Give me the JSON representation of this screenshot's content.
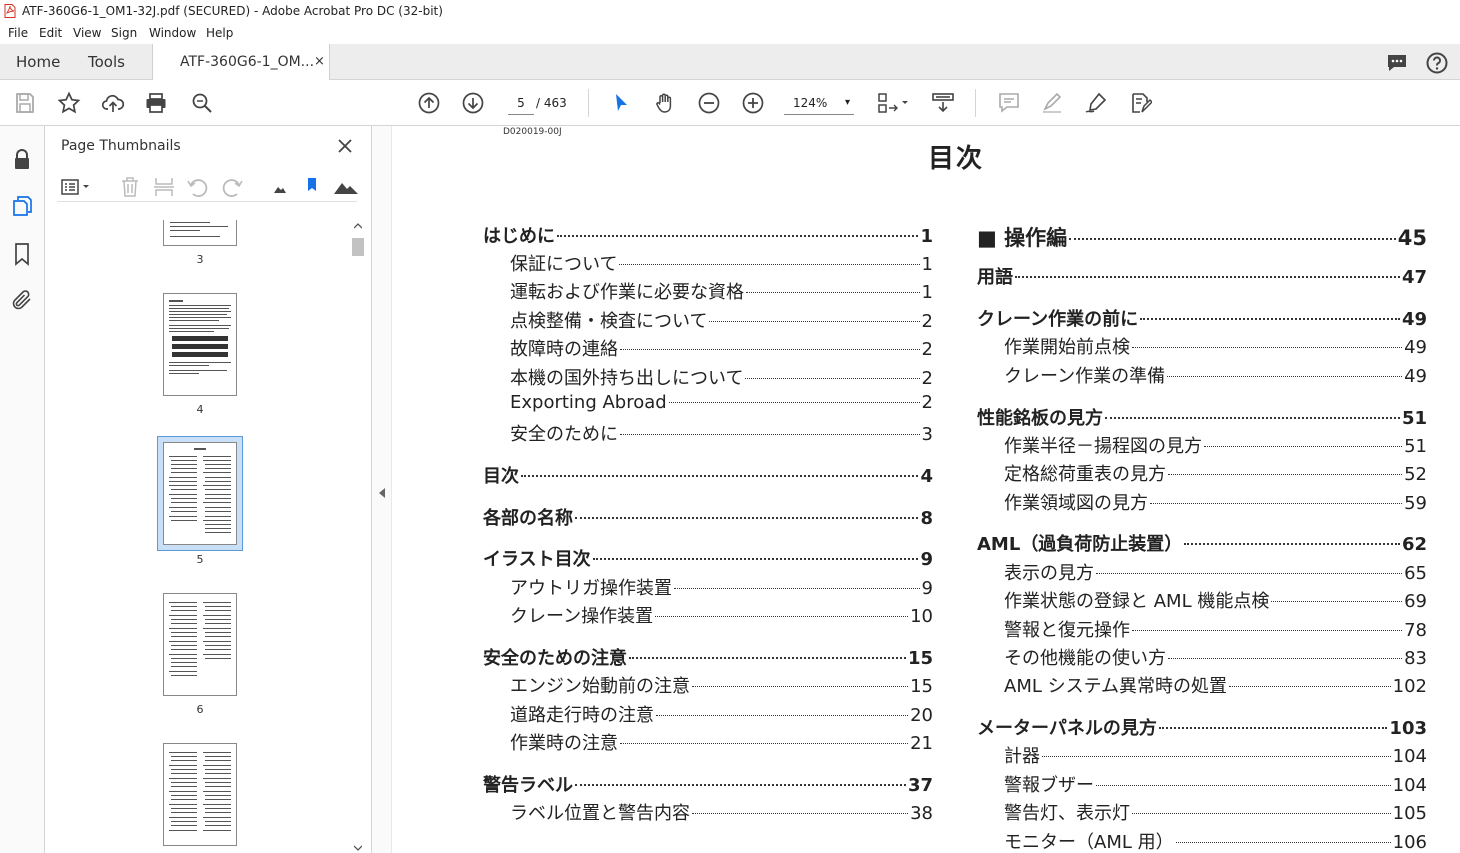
{
  "window": {
    "title": "ATF-360G6-1_OM1-32J.pdf (SECURED) - Adobe Acrobat Pro DC (32-bit)"
  },
  "menu": [
    "File",
    "Edit",
    "View",
    "Sign",
    "Window",
    "Help"
  ],
  "tabs": {
    "home": "Home",
    "tools": "Tools",
    "document": "ATF-360G6-1_OM...",
    "close": "×"
  },
  "toolbar": {
    "page_current": "5",
    "page_total": "/ 463",
    "zoom": "124%",
    "zoom_arrow": "▾"
  },
  "panel": {
    "title": "Page Thumbnails",
    "thumbs": [
      {
        "num": "3"
      },
      {
        "num": "4"
      },
      {
        "num": "5"
      },
      {
        "num": "6"
      },
      {
        "num": ""
      }
    ]
  },
  "colors": {
    "accent": "#1473e6",
    "selected_thumb_bg": "#c9dff7",
    "selected_thumb_border": "#5b9bd5",
    "pdf_red": "#d93025"
  },
  "document": {
    "page_id": "D020019-00J",
    "title": "目次",
    "left_column": [
      {
        "level": "h",
        "text": "はじめに",
        "page": "1"
      },
      {
        "level": "s",
        "text": "保証について",
        "page": "1"
      },
      {
        "level": "s",
        "text": "運転および作業に必要な資格",
        "page": "1"
      },
      {
        "level": "s",
        "text": "点検整備・検査について",
        "page": "2"
      },
      {
        "level": "s",
        "text": "故障時の連絡",
        "page": "2"
      },
      {
        "level": "s",
        "text": "本機の国外持ち出しについて",
        "page": "2"
      },
      {
        "level": "s",
        "text": "Exporting Abroad",
        "page": "2"
      },
      {
        "level": "s",
        "text": "安全のために",
        "page": "3"
      },
      {
        "level": "h",
        "text": "目次",
        "page": "4"
      },
      {
        "level": "h",
        "text": "各部の名称",
        "page": "8"
      },
      {
        "level": "h",
        "text": "イラスト目次",
        "page": "9"
      },
      {
        "level": "s",
        "text": "アウトリガ操作装置",
        "page": "9"
      },
      {
        "level": "s",
        "text": "クレーン操作装置",
        "page": "10"
      },
      {
        "level": "h",
        "text": "安全のための注意",
        "page": "15"
      },
      {
        "level": "s",
        "text": "エンジン始動前の注意",
        "page": "15"
      },
      {
        "level": "s",
        "text": "道路走行時の注意",
        "page": "20"
      },
      {
        "level": "s",
        "text": "作業時の注意",
        "page": "21"
      },
      {
        "level": "h",
        "text": "警告ラベル",
        "page": "37"
      },
      {
        "level": "s",
        "text": "ラベル位置と警告内容",
        "page": "38"
      }
    ],
    "right_column": [
      {
        "level": "big",
        "text": "■ 操作編",
        "page": "45"
      },
      {
        "level": "h",
        "text": "用語",
        "page": "47"
      },
      {
        "level": "h",
        "text": "クレーン作業の前に",
        "page": "49"
      },
      {
        "level": "s",
        "text": "作業開始前点検",
        "page": "49"
      },
      {
        "level": "s",
        "text": "クレーン作業の準備",
        "page": "49"
      },
      {
        "level": "h",
        "text": "性能銘板の見方",
        "page": "51"
      },
      {
        "level": "s",
        "text": "作業半径－揚程図の見方",
        "page": "51"
      },
      {
        "level": "s",
        "text": "定格総荷重表の見方",
        "page": "52"
      },
      {
        "level": "s",
        "text": "作業領域図の見方",
        "page": "59"
      },
      {
        "level": "h",
        "text": "AML（過負荷防止装置）",
        "page": "62"
      },
      {
        "level": "s",
        "text": "表示の見方",
        "page": "65"
      },
      {
        "level": "s",
        "text": "作業状態の登録と AML 機能点検",
        "page": "69"
      },
      {
        "level": "s",
        "text": "警報と復元操作",
        "page": "78"
      },
      {
        "level": "s",
        "text": "その他機能の使い方",
        "page": "83"
      },
      {
        "level": "s",
        "text": "AML システム異常時の処置",
        "page": "102"
      },
      {
        "level": "h",
        "text": "メーターパネルの見方",
        "page": "103"
      },
      {
        "level": "s",
        "text": "計器",
        "page": "104"
      },
      {
        "level": "s",
        "text": "警報ブザー",
        "page": "104"
      },
      {
        "level": "s",
        "text": "警告灯、表示灯",
        "page": "105"
      },
      {
        "level": "s",
        "text": "モニター（AML 用）",
        "page": "106"
      }
    ]
  }
}
